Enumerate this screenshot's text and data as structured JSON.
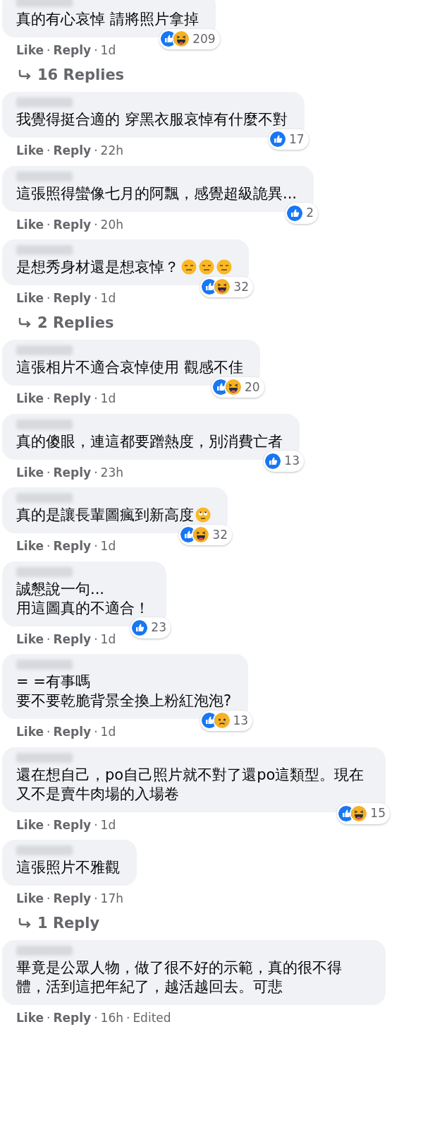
{
  "separator": "·",
  "comments": [
    {
      "lines": [
        "真的有心哀悼 請將照片拿掉"
      ],
      "reactions": [
        {
          "kind": "like"
        },
        {
          "kind": "haha"
        }
      ],
      "count": "209",
      "actions": [
        "Like",
        "Reply"
      ],
      "time": "1d",
      "replies": "16 Replies"
    },
    {
      "lines": [
        "我覺得挺合適的 穿黑衣服哀悼有什麼不對"
      ],
      "reactions": [
        {
          "kind": "like"
        }
      ],
      "count": "17",
      "actions": [
        "Like",
        "Reply"
      ],
      "time": "22h"
    },
    {
      "lines": [
        "這張照得蠻像七月的阿飄，感覺超級詭異..."
      ],
      "reactions": [
        {
          "kind": "like"
        }
      ],
      "count": "2",
      "actions": [
        "Like",
        "Reply"
      ],
      "time": "20h"
    },
    {
      "lines": [
        "是想秀身材還是想哀悼？"
      ],
      "emojis": [
        {
          "kind": "expressionless"
        },
        {
          "kind": "expressionless"
        },
        {
          "kind": "expressionless"
        }
      ],
      "reactions": [
        {
          "kind": "like"
        },
        {
          "kind": "haha"
        }
      ],
      "count": "32",
      "actions": [
        "Like",
        "Reply"
      ],
      "time": "1d",
      "replies": "2 Replies"
    },
    {
      "lines": [
        "這張相片不適合哀悼使用 觀感不佳"
      ],
      "reactions": [
        {
          "kind": "like"
        },
        {
          "kind": "haha"
        }
      ],
      "count": "20",
      "actions": [
        "Like",
        "Reply"
      ],
      "time": "1d"
    },
    {
      "lines": [
        "真的傻眼，連這都要蹭熱度，別消費亡者"
      ],
      "reactions": [
        {
          "kind": "like"
        }
      ],
      "count": "13",
      "actions": [
        "Like",
        "Reply"
      ],
      "time": "23h"
    },
    {
      "lines": [
        "真的是讓長輩圖瘋到新高度"
      ],
      "emojis": [
        {
          "kind": "eye-roll"
        }
      ],
      "reactions": [
        {
          "kind": "like"
        },
        {
          "kind": "haha"
        }
      ],
      "count": "32",
      "actions": [
        "Like",
        "Reply"
      ],
      "time": "1d"
    },
    {
      "lines": [
        "誠懇說一句...",
        "用這圖真的不適合！"
      ],
      "reactions": [
        {
          "kind": "like"
        }
      ],
      "count": "23",
      "actions": [
        "Like",
        "Reply"
      ],
      "time": "1d"
    },
    {
      "lines": [
        "= =有事嗎",
        "要不要乾脆背景全換上粉紅泡泡?"
      ],
      "reactions": [
        {
          "kind": "like"
        },
        {
          "kind": "sad"
        }
      ],
      "count": "13",
      "actions": [
        "Like",
        "Reply"
      ],
      "time": "1d"
    },
    {
      "lines": [
        "還在想自己，po自己照片就不對了還po這類型。現在又不是賣牛肉場的入場卷"
      ],
      "reactions": [
        {
          "kind": "like"
        },
        {
          "kind": "haha"
        }
      ],
      "count": "15",
      "actions": [
        "Like",
        "Reply"
      ],
      "time": "1d"
    },
    {
      "lines": [
        "這張照片不雅觀"
      ],
      "actions": [
        "Like",
        "Reply"
      ],
      "time": "17h",
      "replies": "1 Reply"
    },
    {
      "lines": [
        "畢竟是公眾人物，做了很不好的示範，真的很不得體，活到這把年紀了，越活越回去。可悲"
      ],
      "actions": [
        "Like",
        "Reply"
      ],
      "time": "16h",
      "edited": "Edited"
    }
  ]
}
